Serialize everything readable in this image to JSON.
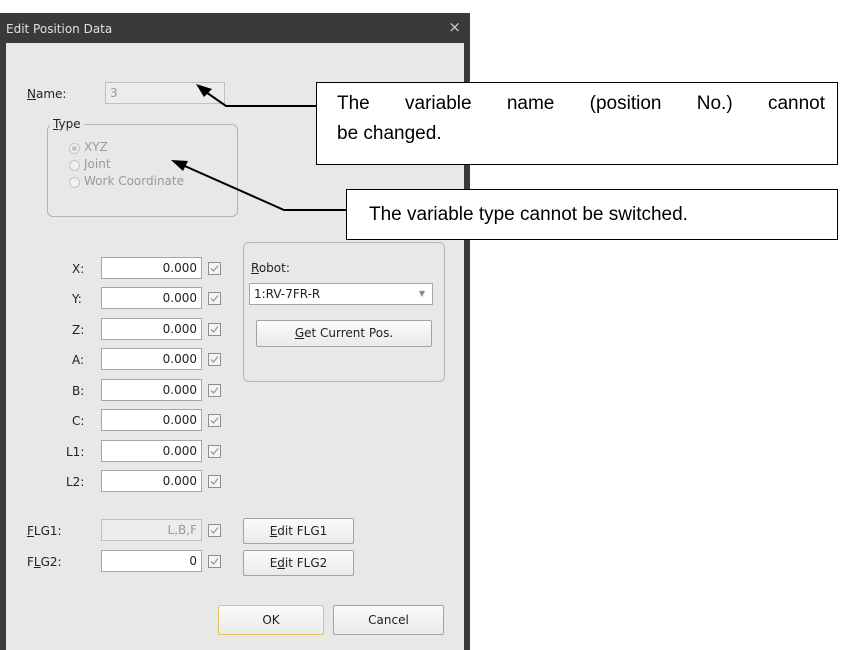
{
  "dialog": {
    "title": "Edit Position Data",
    "close_glyph": "×",
    "name_label_u": "N",
    "name_label_rest": "ame:",
    "name_value": "3",
    "type_group": {
      "label_u": "T",
      "label_rest": "ype",
      "options": [
        {
          "label": "XYZ",
          "selected": true
        },
        {
          "label": "Joint",
          "selected": false
        },
        {
          "label": "Work Coordinate",
          "selected": false
        }
      ]
    },
    "coords": [
      {
        "label": "X:",
        "value": "0.000"
      },
      {
        "label": "Y:",
        "value": "0.000"
      },
      {
        "label": "Z:",
        "value": "0.000"
      },
      {
        "label": "A:",
        "value": "0.000"
      },
      {
        "label": "B:",
        "value": "0.000"
      },
      {
        "label": "C:",
        "value": "0.000"
      },
      {
        "label": "L1:",
        "value": "0.000"
      },
      {
        "label": "L2:",
        "value": "0.000"
      }
    ],
    "robot_group": {
      "label_u": "R",
      "label_rest": "obot:",
      "selected": "1:RV-7FR-R",
      "get_pos_u": "G",
      "get_pos_rest": "et Current Pos."
    },
    "flg1": {
      "label_u": "F",
      "label_rest": "LG1:",
      "value": "L,B,F",
      "button_u": "E",
      "button_rest": "dit FLG1"
    },
    "flg2": {
      "label_pre": "F",
      "label_u": "L",
      "label_rest": "G2:",
      "value": "0",
      "button_pre": "E",
      "button_u": "d",
      "button_rest": "it FLG2"
    },
    "ok_label": "OK",
    "cancel_label": "Cancel"
  },
  "annotations": {
    "name_note_line1": "The variable name (position No.) cannot",
    "name_note_line2": "be changed.",
    "type_note": "The variable type cannot be switched."
  },
  "colors": {
    "titlebar": "#3a3a3a",
    "client": "#e8e8e8",
    "default_button_border": "#e6c25d"
  }
}
